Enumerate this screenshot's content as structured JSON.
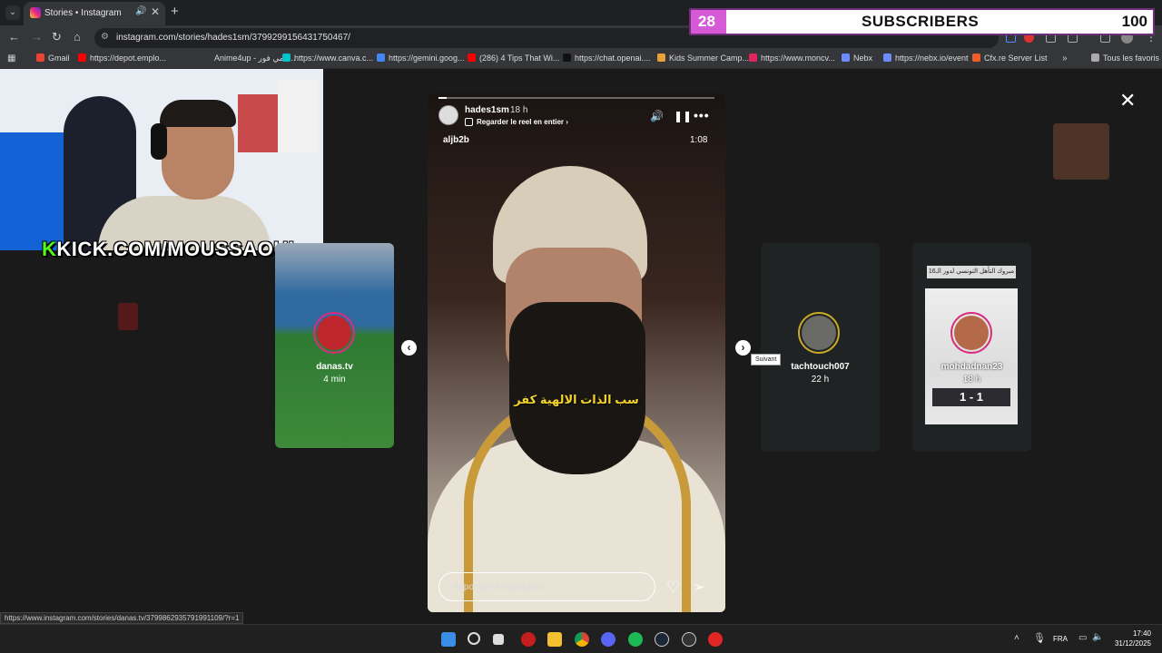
{
  "browser": {
    "tab_title": "Stories • Instagram",
    "url": "instagram.com/stories/hades1sm/3799299156431750467/",
    "status_url": "https://www.instagram.com/stories/danas.tv/3799862935791991109/?r=1"
  },
  "subscriber_goal": {
    "current": "28",
    "label": "SUBSCRIBERS",
    "goal": "100",
    "progress_fraction": 0.28
  },
  "bookmarks": [
    {
      "label": "Gmail",
      "icon_color": "#ea4335"
    },
    {
      "label": "https://depot.emplo...",
      "icon_color": "#ff0000"
    },
    {
      "label": "Anime4up - انمي فور...",
      "icon_color": "#35363a"
    },
    {
      "label": "https://www.canva.c...",
      "icon_color": "#00c4cc"
    },
    {
      "label": "https://gemini.goog...",
      "icon_color": "#4285f4"
    },
    {
      "label": "(286) 4 Tips That Wi...",
      "icon_color": "#ff0000"
    },
    {
      "label": "https://chat.openai....",
      "icon_color": "#111111"
    },
    {
      "label": "Kids Summer Camp...",
      "icon_color": "#e8a33a"
    },
    {
      "label": "https://www.moncv...",
      "icon_color": "#e0245e"
    },
    {
      "label": "Nebx",
      "icon_color": "#6a8cff"
    },
    {
      "label": "https://nebx.io/event",
      "icon_color": "#6a8cff"
    },
    {
      "label": "Cfx.re Server List",
      "icon_color": "#f25c28"
    }
  ],
  "bookmarks_other": "Tous les favoris",
  "webcam": {
    "overlay_k": "K",
    "overlay_text": "KICK.COM/MOUSSAOUI"
  },
  "stories_left": {
    "username": "danas.tv",
    "time": "4 min"
  },
  "stories_right1": {
    "username": "tachtouch007",
    "time": "22 h"
  },
  "stories_right2": {
    "username": "mohdadnan23",
    "time": "18 h",
    "banner": "مبروك التأهل التونسي لدور الـ16",
    "score": "1 - 1"
  },
  "main_story": {
    "username": "hades1sm",
    "time": "18 h",
    "reel_link": "Regarder le reel en entier",
    "tag": "aljb2b",
    "duration": "1:08",
    "subtitle": "سب الذات الالهية كفر",
    "reply_placeholder": "Répondre à hades1sm...",
    "progress_fraction": 0.03
  },
  "tooltip": "Suivant",
  "taskbar": {
    "lang": "FRA",
    "time": "17:40",
    "date": "31/12/2025"
  },
  "colors": {
    "kick_green": "#53fc18",
    "subs_fill": "#d65ad6",
    "subtitle_yellow": "#f2d22b"
  }
}
